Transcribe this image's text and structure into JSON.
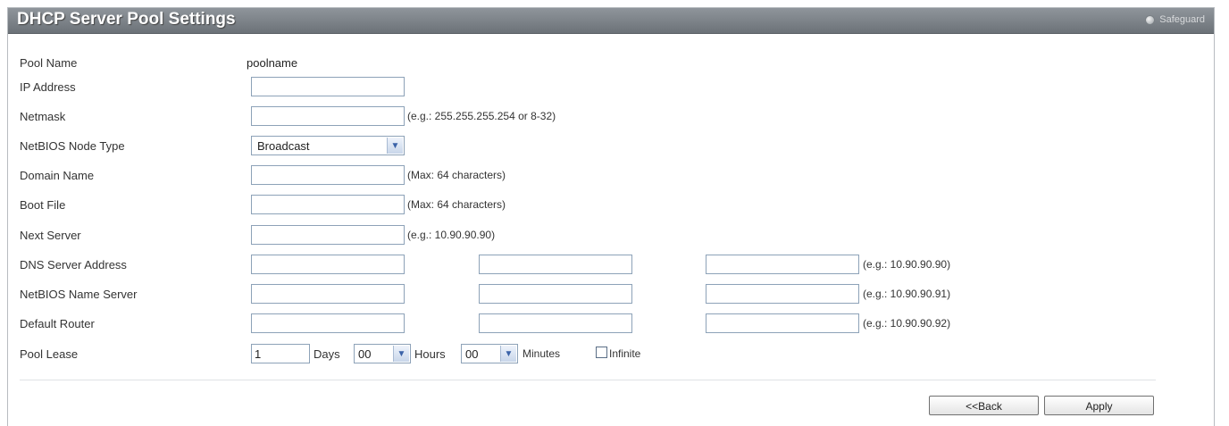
{
  "header": {
    "title": "DHCP Server Pool Settings",
    "safeguard_label": "Safeguard"
  },
  "form": {
    "pool_name": {
      "label": "Pool Name",
      "value": "poolname"
    },
    "ip_address": {
      "label": "IP Address",
      "value": ""
    },
    "netmask": {
      "label": "Netmask",
      "value": "",
      "hint": "(e.g.: 255.255.255.254 or 8-32)"
    },
    "netbios_node_type": {
      "label": "NetBIOS Node Type",
      "selected": "Broadcast"
    },
    "domain_name": {
      "label": "Domain Name",
      "value": "",
      "hint": "(Max: 64 characters)"
    },
    "boot_file": {
      "label": "Boot File",
      "value": "",
      "hint": "(Max: 64 characters)"
    },
    "next_server": {
      "label": "Next Server",
      "value": "",
      "hint": "(e.g.: 10.90.90.90)"
    },
    "dns_server_address": {
      "label": "DNS Server Address",
      "values": [
        "",
        "",
        ""
      ],
      "hint": "(e.g.: 10.90.90.90)"
    },
    "netbios_name_server": {
      "label": "NetBIOS Name Server",
      "values": [
        "",
        "",
        ""
      ],
      "hint": "(e.g.: 10.90.90.91)"
    },
    "default_router": {
      "label": "Default Router",
      "values": [
        "",
        "",
        ""
      ],
      "hint": "(e.g.: 10.90.90.92)"
    },
    "pool_lease": {
      "label": "Pool Lease",
      "days_value": "1",
      "days_label": "Days",
      "hours_selected": "00",
      "hours_label": "Hours",
      "minutes_selected": "00",
      "minutes_label": "Minutes",
      "infinite_label": "Infinite",
      "infinite_checked": false
    }
  },
  "actions": {
    "back_label": "<<Back",
    "apply_label": "Apply"
  },
  "icons": {
    "safeguard": "safeguard-status-icon",
    "dropdown": "chevron-down-icon"
  },
  "colors": {
    "title_bar": "#7a8086",
    "field_border": "#8da2b8",
    "arrow": "#3b63a8"
  }
}
